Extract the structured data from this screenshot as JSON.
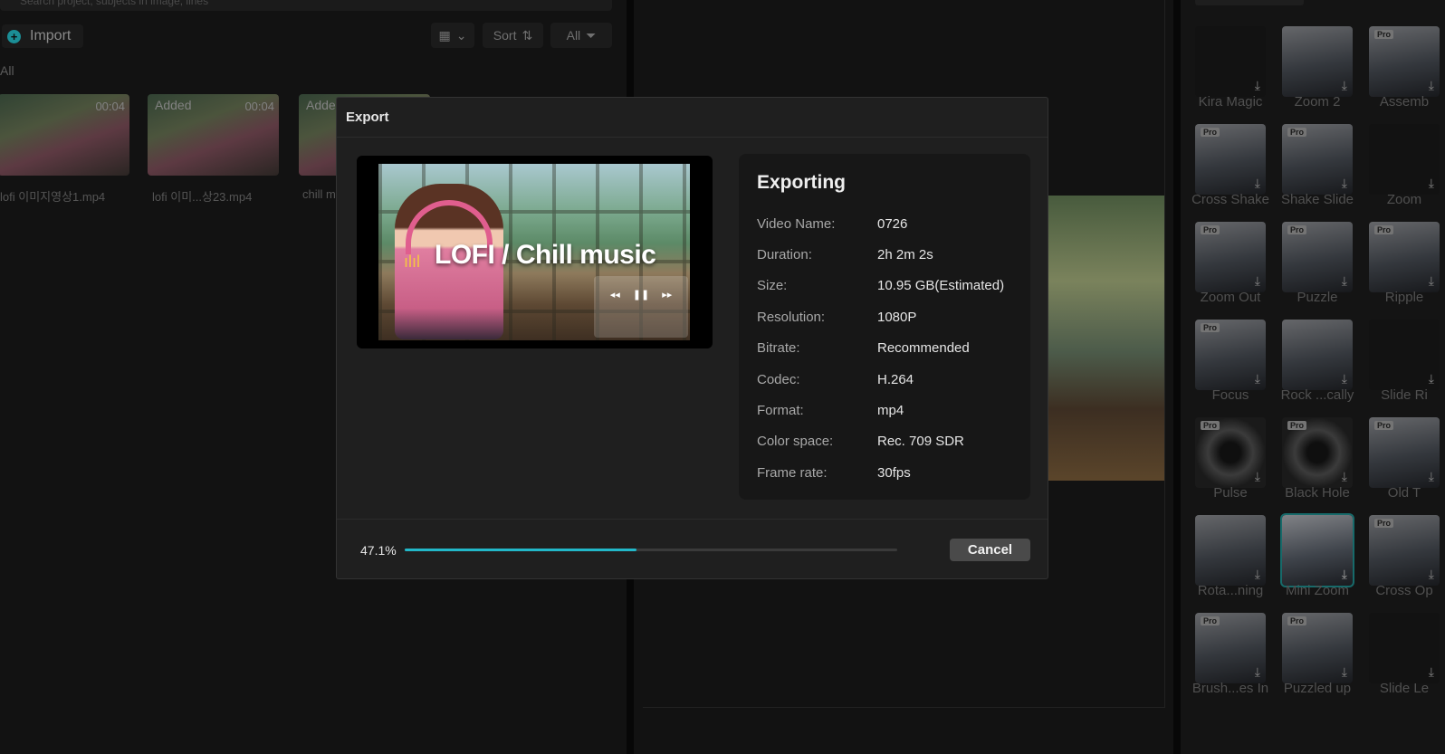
{
  "media_panel": {
    "search_placeholder": "Search project, subjects in image, lines",
    "import_label": "Import",
    "sort_label": "Sort",
    "filter_label": "All",
    "all_label": "All",
    "clips": [
      {
        "name": "lofi 이미지영상1.mp4",
        "duration": "00:04",
        "badge": ""
      },
      {
        "name": "lofi 이미...상23.mp4",
        "duration": "00:04",
        "badge": "Added"
      },
      {
        "name": "chill m",
        "duration": "",
        "badge": "Adde"
      }
    ]
  },
  "effects_panel": {
    "items": [
      {
        "label": "Kira Magic",
        "pro": false
      },
      {
        "label": "Zoom 2",
        "pro": false
      },
      {
        "label": "Assemb",
        "pro": true
      },
      {
        "label": "Cross Shake",
        "pro": true
      },
      {
        "label": "Shake Slide",
        "pro": true
      },
      {
        "label": "Zoom",
        "pro": false
      },
      {
        "label": "Zoom Out",
        "pro": true
      },
      {
        "label": "Puzzle",
        "pro": true
      },
      {
        "label": "Ripple",
        "pro": true
      },
      {
        "label": "Focus",
        "pro": true
      },
      {
        "label": "Rock ...cally",
        "pro": false
      },
      {
        "label": "Slide Ri",
        "pro": false
      },
      {
        "label": "Pulse",
        "pro": true
      },
      {
        "label": "Black Hole",
        "pro": true
      },
      {
        "label": "Old T",
        "pro": true
      },
      {
        "label": "Rota...ning",
        "pro": false
      },
      {
        "label": "Mini Zoom",
        "pro": false
      },
      {
        "label": "Cross Op",
        "pro": true
      },
      {
        "label": "Brush...es In",
        "pro": true
      },
      {
        "label": "Puzzled up",
        "pro": true
      },
      {
        "label": "Slide Le",
        "pro": false
      }
    ],
    "pro_badge": "Pro",
    "download_icon": "download-icon"
  },
  "export_dialog": {
    "title": "Export",
    "preview_title": "LOFI / Chill music",
    "status_title": "Exporting",
    "details": [
      {
        "key": "Video Name:",
        "value": "0726"
      },
      {
        "key": "Duration:",
        "value": "2h 2m 2s"
      },
      {
        "key": "Size:",
        "value": "10.95 GB(Estimated)"
      },
      {
        "key": "Resolution:",
        "value": "1080P"
      },
      {
        "key": "Bitrate:",
        "value": "Recommended"
      },
      {
        "key": "Codec:",
        "value": "H.264"
      },
      {
        "key": "Format:",
        "value": "mp4"
      },
      {
        "key": "Color space:",
        "value": "Rec. 709 SDR"
      },
      {
        "key": "Frame rate:",
        "value": "30fps"
      }
    ],
    "progress_text": "47.1%",
    "progress_value": 47.1,
    "cancel_label": "Cancel",
    "accent_color": "#22b8c9"
  }
}
